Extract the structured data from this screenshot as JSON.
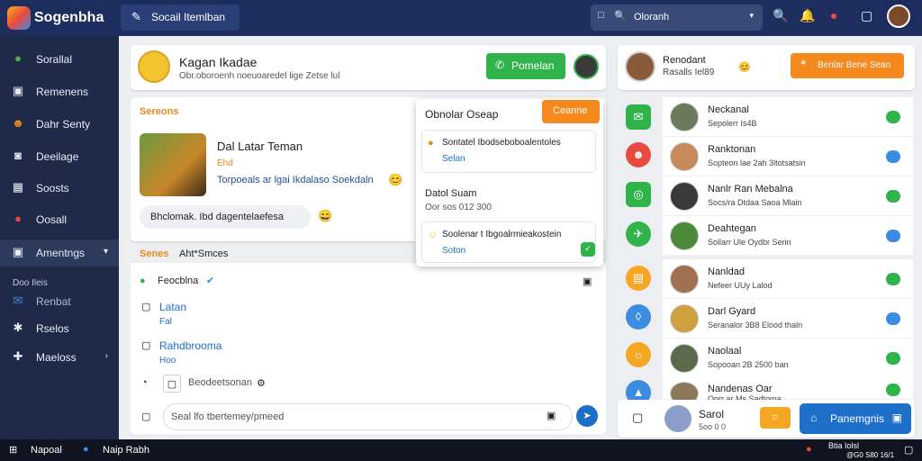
{
  "app": {
    "name": "Sogenbha"
  },
  "topbar": {
    "compose_label": "Socail Itemlban",
    "search_placeholder": "Oloranh"
  },
  "sidebar": {
    "items": [
      {
        "label": "Sorallal"
      },
      {
        "label": "Remenens"
      },
      {
        "label": "Dahr Senty"
      },
      {
        "label": "Deeilage"
      },
      {
        "label": "Soosts"
      },
      {
        "label": "Oosall"
      },
      {
        "label": "Amentngs"
      },
      {
        "label": "Renbat"
      },
      {
        "label": "Rselos"
      },
      {
        "label": "Maeloss"
      }
    ],
    "section_label": "Doo Ileis"
  },
  "profile_header": {
    "title": "Kagan Ikadae",
    "subtitle": "Obr.oboroenh noeuoaredel lige Zetse lul",
    "action_label": "Pomelan"
  },
  "feed": {
    "section_title": "Sereons",
    "post": {
      "title": "Dal Latar Teman",
      "meta": "Ehd",
      "description": "Torpoeals ar lgai Ikdalaso Soekdaln"
    },
    "comment": "Bhclomak. Ibd dagentelaefesa",
    "tabs": [
      "Senes",
      "Aht*Smces"
    ]
  },
  "popup": {
    "title": "Obnolar Oseap",
    "button_label": "Ceanne",
    "cards": [
      {
        "text": "Sontatel Ibodseboboalentoles",
        "link": "Selan"
      },
      {
        "text": "Datol Suam",
        "meta": "Oor sos 012 300"
      },
      {
        "text": "Soolenar t Ibgoalrmieakostein",
        "link": "Soton"
      }
    ]
  },
  "chat": {
    "header": "Feocblna",
    "items": [
      {
        "label": "Latan",
        "sub": "Fal"
      },
      {
        "label": "Rahdbrooma",
        "sub": "Hoo"
      }
    ],
    "footer_label": "Beodeetsonan",
    "input_placeholder": "Seal lfo tbertemey/pmeed"
  },
  "right_header": {
    "name": "Renodant",
    "sub": "Rasalls Iel89",
    "action_label": "Benlar Bene Sean"
  },
  "friends": [
    {
      "name": "Neckanal",
      "status": "Sepolerr Is4B"
    },
    {
      "name": "Ranktonan",
      "status": "Sopteon lae 2ah 3ltotsatsin"
    },
    {
      "name": "Nanlr Ran Mebalna",
      "status": "Socs/ra Dtdaa Saoa Mlain"
    },
    {
      "name": "Deahtegan",
      "status": "Sollarr Ule Oydbr Serin"
    },
    {
      "name": "Nanldad",
      "status": "Nefeer UUy Lalod"
    },
    {
      "name": "Darl Gyard",
      "status": "Seranalor 3B8 Elood thaln"
    },
    {
      "name": "Naolaal",
      "status": "Sopooan 2B 2500 ban"
    },
    {
      "name": "Nandenas Oar",
      "status": "Oorr ar Ms Sadtoma"
    }
  ],
  "bottom_card": {
    "name": "Sarol",
    "meta": "5oo 0 0",
    "primary_label": "Panemgnis"
  },
  "taskbar": {
    "left_label": "Napoal",
    "center_label": "Naip Rabh",
    "right_top": "Btia Iolsl",
    "right_bottom": "@G0 S80 16/1"
  }
}
